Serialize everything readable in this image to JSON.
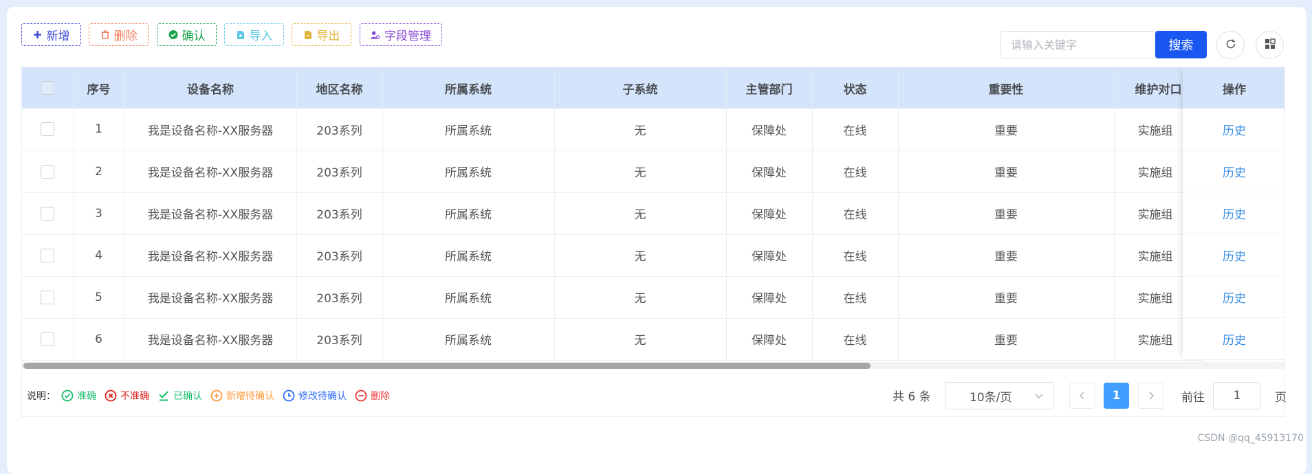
{
  "toolbar": {
    "add": "新增",
    "delete": "删除",
    "confirm": "确认",
    "import": "导入",
    "export": "导出",
    "fields": "字段管理"
  },
  "search": {
    "placeholder": "请输入关键字",
    "button": "搜索"
  },
  "table": {
    "columns": [
      "序号",
      "设备名称",
      "地区名称",
      "所属系统",
      "子系统",
      "主管部门",
      "状态",
      "重要性",
      "维护对口",
      "操作"
    ],
    "rows": [
      {
        "no": "1",
        "name": "我是设备名称-XX服务器",
        "region": "203系列",
        "system": "所属系统",
        "subsystem": "无",
        "dept": "保障处",
        "status": "在线",
        "importance": "重要",
        "maint": "实施组",
        "op": "历史"
      },
      {
        "no": "2",
        "name": "我是设备名称-XX服务器",
        "region": "203系列",
        "system": "所属系统",
        "subsystem": "无",
        "dept": "保障处",
        "status": "在线",
        "importance": "重要",
        "maint": "实施组",
        "op": "历史"
      },
      {
        "no": "3",
        "name": "我是设备名称-XX服务器",
        "region": "203系列",
        "system": "所属系统",
        "subsystem": "无",
        "dept": "保障处",
        "status": "在线",
        "importance": "重要",
        "maint": "实施组",
        "op": "历史"
      },
      {
        "no": "4",
        "name": "我是设备名称-XX服务器",
        "region": "203系列",
        "system": "所属系统",
        "subsystem": "无",
        "dept": "保障处",
        "status": "在线",
        "importance": "重要",
        "maint": "实施组",
        "op": "历史"
      },
      {
        "no": "5",
        "name": "我是设备名称-XX服务器",
        "region": "203系列",
        "system": "所属系统",
        "subsystem": "无",
        "dept": "保障处",
        "status": "在线",
        "importance": "重要",
        "maint": "实施组",
        "op": "历史"
      },
      {
        "no": "6",
        "name": "我是设备名称-XX服务器",
        "region": "203系列",
        "system": "所属系统",
        "subsystem": "无",
        "dept": "保障处",
        "status": "在线",
        "importance": "重要",
        "maint": "实施组",
        "op": "历史"
      }
    ]
  },
  "legend": {
    "label": "说明：",
    "items": [
      {
        "text": "准确",
        "icon": "check-circle-icon",
        "color": "#19be6b"
      },
      {
        "text": "不准确",
        "icon": "x-circle-icon",
        "color": "#e02020"
      },
      {
        "text": "已确认",
        "icon": "check-underline-icon",
        "color": "#19be6b"
      },
      {
        "text": "新增待确认",
        "icon": "plus-circle-icon",
        "color": "#ff9a3c"
      },
      {
        "text": "修改待确认",
        "icon": "clock-icon",
        "color": "#2f6bff"
      },
      {
        "text": "删除",
        "icon": "minus-circle-icon",
        "color": "#ee3a3a"
      }
    ]
  },
  "pagination": {
    "total": "共 6 条",
    "page_size": "10条/页",
    "current": "1",
    "goto_label": "前往",
    "goto_value": "1",
    "goto_unit": "页"
  },
  "watermark": "CSDN @qq_45913170",
  "colors": {
    "primary": "#1a56f0",
    "header_bg": "#d4e5fb",
    "link": "#3a8ee6",
    "add": "#3a4bd6",
    "delete": "#f07b5a",
    "confirm": "#1aa34a",
    "import": "#5cc8e8",
    "export": "#e0b43a",
    "fields": "#8a4cd6"
  }
}
